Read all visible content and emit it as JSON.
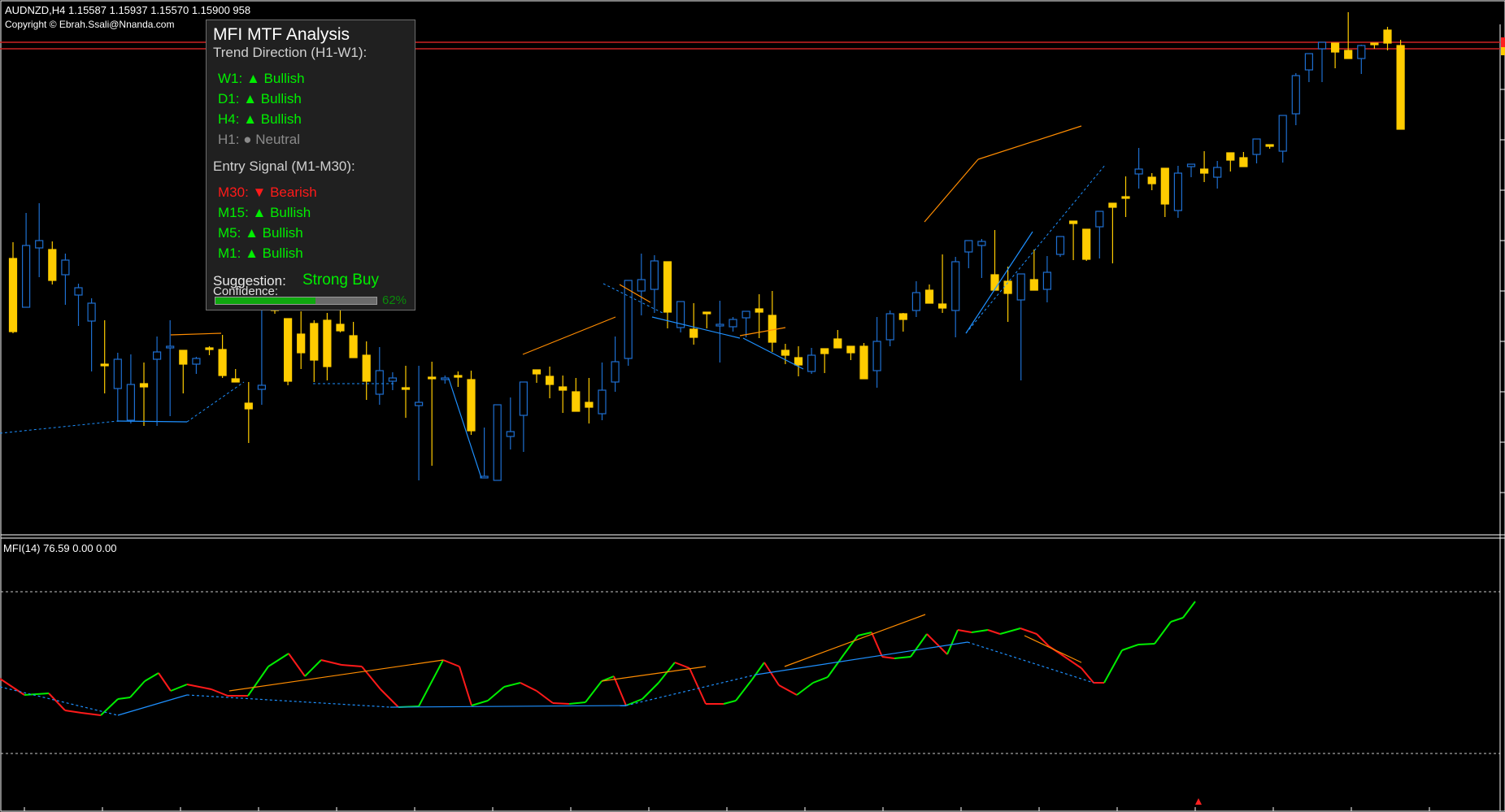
{
  "header": {
    "symbol_line": "AUDNZD,H4  1.15587 1.15937 1.15570 1.15900  958",
    "copyright": "Copyright © Ebrah.Ssali@Nnanda.com"
  },
  "indicator": {
    "label": "MFI(14) 76.59 0.00 0.00"
  },
  "panel": {
    "title": "MFI MTF Analysis",
    "trend_heading": "Trend Direction (H1-W1):",
    "trend": [
      {
        "tf": "W1:",
        "arrow": "▲",
        "state": "Bullish",
        "color": "#00ee00"
      },
      {
        "tf": "D1:",
        "arrow": "▲",
        "state": "Bullish",
        "color": "#00ee00"
      },
      {
        "tf": "H4:",
        "arrow": "▲",
        "state": "Bullish",
        "color": "#00ee00"
      },
      {
        "tf": "H1:",
        "arrow": "●",
        "state": "Neutral",
        "color": "#8a8a8a"
      }
    ],
    "entry_heading": "Entry Signal (M1-M30):",
    "entry": [
      {
        "tf": "M30:",
        "arrow": "▼",
        "state": "Bearish",
        "color": "#ff1a1a"
      },
      {
        "tf": "M15:",
        "arrow": "▲",
        "state": "Bullish",
        "color": "#00ee00"
      },
      {
        "tf": "M5:",
        "arrow": "▲",
        "state": "Bullish",
        "color": "#00ee00"
      },
      {
        "tf": "M1:",
        "arrow": "▲",
        "state": "Bullish",
        "color": "#00ee00"
      }
    ],
    "suggestion_label": "Suggestion:",
    "suggestion_value": "Strong Buy",
    "suggestion_color": "#00ee00",
    "confidence_label": "Confidence:",
    "confidence_pct": "62%",
    "confidence_fraction": 0.62
  },
  "colors": {
    "bull_candle": "#1e6fd0",
    "bear_candle": "#ffcc00",
    "mfi_up": "#00ee00",
    "mfi_down": "#ff1a1a",
    "divergence_top": "#ff8c00",
    "divergence_bottom": "#1e90ff",
    "price_line": "#cc2222",
    "grid": "#c8c8c8"
  },
  "chart_data": {
    "type": "candlestick",
    "candles": [
      [
        318,
        298,
        410,
        408
      ],
      [
        378,
        262,
        302,
        302
      ],
      [
        305,
        250,
        341,
        296
      ],
      [
        307,
        297,
        350,
        345
      ],
      [
        338,
        312,
        375,
        320
      ],
      [
        363,
        349,
        401,
        354
      ],
      [
        395,
        367,
        457,
        373
      ],
      [
        448,
        394,
        484,
        448
      ],
      [
        478,
        434,
        519,
        442
      ],
      [
        517,
        436,
        521,
        473
      ],
      [
        472,
        446,
        524,
        476
      ],
      [
        442,
        414,
        524,
        433
      ],
      [
        428,
        394,
        512,
        426
      ],
      [
        431,
        434,
        484,
        448
      ],
      [
        448,
        439,
        460,
        441
      ],
      [
        428,
        426,
        437,
        429
      ],
      [
        430,
        412,
        465,
        462
      ],
      [
        466,
        454,
        469,
        470
      ],
      [
        496,
        470,
        545,
        503
      ],
      [
        479,
        326,
        498,
        474
      ],
      [
        353,
        338,
        386,
        382
      ],
      [
        392,
        392,
        474,
        469
      ],
      [
        411,
        383,
        454,
        434
      ],
      [
        398,
        394,
        470,
        443
      ],
      [
        394,
        385,
        468,
        451
      ],
      [
        399,
        371,
        409,
        407
      ],
      [
        413,
        396,
        438,
        440
      ],
      [
        437,
        420,
        492,
        469
      ],
      [
        485,
        427,
        498,
        456
      ],
      [
        469,
        458,
        480,
        465
      ],
      [
        477,
        450,
        514,
        477
      ],
      [
        499,
        450,
        591,
        495
      ],
      [
        464,
        445,
        573,
        465
      ],
      [
        466,
        462,
        472,
        465
      ],
      [
        462,
        457,
        476,
        463
      ],
      [
        467,
        456,
        535,
        530
      ],
      [
        588,
        526,
        588,
        586
      ],
      [
        591,
        500,
        586,
        498
      ],
      [
        537,
        489,
        553,
        531
      ],
      [
        511,
        472,
        556,
        470
      ],
      [
        455,
        456,
        471,
        460
      ],
      [
        463,
        451,
        490,
        473
      ],
      [
        476,
        462,
        508,
        480
      ],
      [
        482,
        465,
        500,
        506
      ],
      [
        495,
        465,
        521,
        501
      ],
      [
        509,
        446,
        517,
        480
      ],
      [
        470,
        414,
        482,
        445
      ],
      [
        441,
        356,
        450,
        345
      ],
      [
        358,
        312,
        388,
        344
      ],
      [
        356,
        314,
        385,
        321
      ],
      [
        322,
        386,
        404,
        384
      ],
      [
        403,
        408,
        409,
        371
      ],
      [
        405,
        373,
        424,
        415
      ],
      [
        384,
        384,
        404,
        384
      ],
      [
        400,
        370,
        446,
        399
      ],
      [
        402,
        390,
        408,
        393
      ],
      [
        391,
        386,
        415,
        383
      ],
      [
        380,
        362,
        416,
        384
      ],
      [
        388,
        358,
        433,
        421
      ],
      [
        431,
        423,
        448,
        437
      ],
      [
        440,
        426,
        463,
        449
      ],
      [
        457,
        428,
        460,
        437
      ],
      [
        429,
        432,
        459,
        435
      ],
      [
        417,
        406,
        427,
        428
      ],
      [
        426,
        433,
        443,
        434
      ],
      [
        426,
        422,
        463,
        466
      ],
      [
        456,
        390,
        477,
        420
      ],
      [
        418,
        382,
        426,
        386
      ],
      [
        386,
        385,
        408,
        393
      ],
      [
        382,
        346,
        390,
        360
      ],
      [
        357,
        350,
        373,
        373
      ],
      [
        374,
        313,
        385,
        379
      ],
      [
        382,
        316,
        415,
        322
      ],
      [
        310,
        301,
        330,
        296
      ],
      [
        302,
        294,
        342,
        297
      ],
      [
        338,
        283,
        350,
        357
      ],
      [
        346,
        328,
        396,
        361
      ],
      [
        369,
        339,
        468,
        337
      ],
      [
        344,
        307,
        355,
        357
      ],
      [
        356,
        315,
        372,
        335
      ],
      [
        313,
        295,
        316,
        291
      ],
      [
        272,
        285,
        320,
        275
      ],
      [
        282,
        286,
        321,
        319
      ],
      [
        279,
        313,
        318,
        260
      ],
      [
        250,
        251,
        324,
        255
      ],
      [
        242,
        217,
        267,
        244
      ],
      [
        214,
        182,
        232,
        208
      ],
      [
        218,
        213,
        234,
        226
      ],
      [
        207,
        209,
        267,
        251
      ],
      [
        259,
        204,
        268,
        213
      ],
      [
        205,
        208,
        218,
        202
      ],
      [
        208,
        186,
        224,
        213
      ],
      [
        218,
        198,
        232,
        206
      ],
      [
        188,
        192,
        211,
        197
      ],
      [
        194,
        187,
        199,
        205
      ],
      [
        190,
        180,
        201,
        171
      ],
      [
        178,
        183,
        183,
        178
      ],
      [
        186,
        150,
        200,
        142
      ],
      [
        140,
        90,
        154,
        93
      ],
      [
        86,
        75,
        101,
        66
      ],
      [
        60,
        60,
        101,
        52
      ],
      [
        53,
        60,
        84,
        64
      ],
      [
        62,
        15,
        69,
        72
      ],
      [
        72,
        55,
        91,
        56
      ],
      [
        53,
        60,
        60,
        54
      ],
      [
        37,
        33,
        62,
        53
      ],
      [
        56,
        49,
        156,
        159
      ]
    ]
  }
}
